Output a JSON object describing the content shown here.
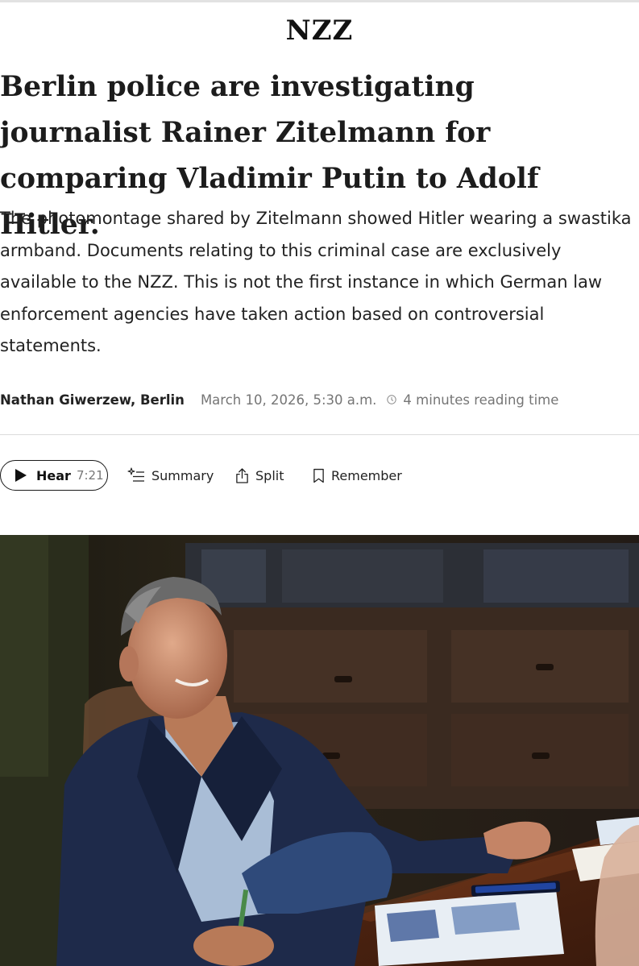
{
  "brand": {
    "logo": "NZZ"
  },
  "article": {
    "headline": "Berlin police are investigating journalist Rainer Zitelmann for comparing Vladimir Putin to Adolf Hitler.",
    "lead": "The photomontage shared by Zitelmann showed Hitler wearing a swastika armband. Documents relating to this criminal case are exclusively available to the NZZ. This is not the first instance in which German law enforcement agencies have taken action based on controversial statements.",
    "author": "Nathan Giwerzew, Berlin",
    "date": "March 10, 2026, 5:30 a.m.",
    "reading_time": "4 minutes reading time"
  },
  "toolbar": {
    "hear_label": "Hear",
    "hear_duration": "7:21",
    "summary_label": "Summary",
    "split_label": "Split",
    "remember_label": "Remember"
  },
  "icons": {
    "play": "play-icon",
    "summary": "sparkle-list-icon",
    "split": "share-icon",
    "remember": "bookmark-icon",
    "clock": "clock-icon"
  },
  "colors": {
    "text": "#1c1c1c",
    "muted": "#757575",
    "divider": "#dcdcdc"
  }
}
